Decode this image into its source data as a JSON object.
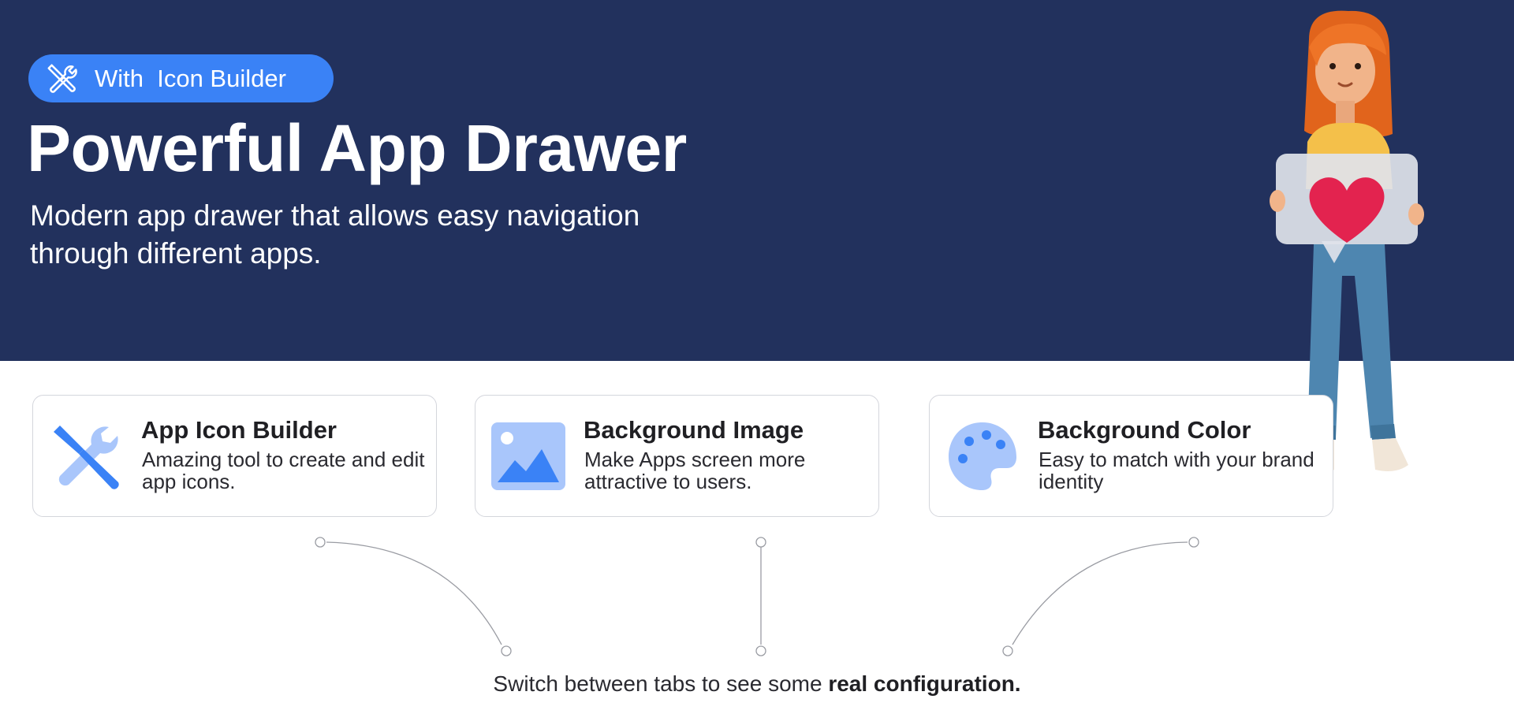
{
  "hero": {
    "badge": {
      "label": "With  Icon Builder",
      "icon": "tools-icon"
    },
    "title": "Powerful App Drawer",
    "subtitle": "Modern app drawer that allows easy navigation through different apps.",
    "illustration": "girl-holding-heart-sign-illustration"
  },
  "features": [
    {
      "title": "App Icon Builder",
      "description": "Amazing tool to create and edit app icons.",
      "icon": "wrench-screwdriver-icon"
    },
    {
      "title": "Background Image",
      "description": "Make Apps screen more attractive to users.",
      "icon": "image-icon"
    },
    {
      "title": "Background Color",
      "description": "Easy to match with your brand identity",
      "icon": "palette-icon"
    }
  ],
  "footer": {
    "text_prefix": "Switch between tabs to see some ",
    "text_bold": "real configuration."
  },
  "colors": {
    "hero_background": "#22315d",
    "accent": "#3a82f6",
    "icon_light": "#a9c6fb",
    "card_border": "#d4d6dc"
  }
}
